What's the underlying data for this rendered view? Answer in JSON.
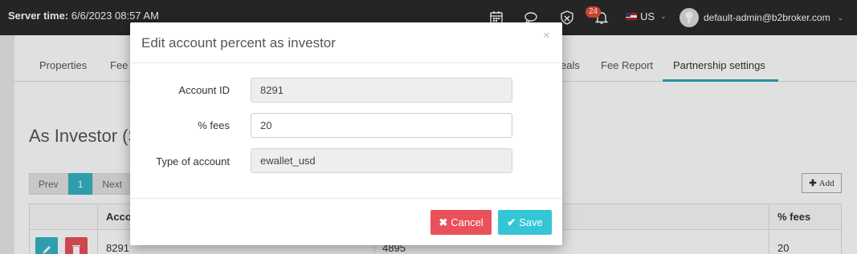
{
  "topbar": {
    "server_time_label": "Server time:",
    "server_time_value": "6/6/2023 08:57 AM",
    "notification_count": "24",
    "language": "US",
    "user_email": "default-admin@b2broker.com"
  },
  "tabs": [
    {
      "label": "Properties"
    },
    {
      "label": "Fee"
    },
    {
      "label": "eals"
    },
    {
      "label": "Fee Report"
    },
    {
      "label": "Partnership settings"
    }
  ],
  "section": {
    "title": "As Investor (S"
  },
  "pager": {
    "prev": "Prev",
    "current": "1",
    "next": "Next"
  },
  "add_button": "Add",
  "table": {
    "headers": {
      "account": "Acco",
      "fees": "% fees"
    },
    "row": {
      "account": "8291",
      "middle": "4895",
      "fees": "20"
    }
  },
  "modal": {
    "title": "Edit account percent as investor",
    "close": "×",
    "fields": [
      {
        "label": "Account ID",
        "value": "8291",
        "readonly": true
      },
      {
        "label": "% fees",
        "value": "20",
        "readonly": false
      },
      {
        "label": "Type of account",
        "value": "ewallet_usd",
        "readonly": true
      }
    ],
    "cancel_label": "Cancel",
    "save_label": "Save"
  },
  "colors": {
    "topbar": "#2b2b2b",
    "accent": "#35b3c6",
    "cancel": "#e9505a",
    "save": "#35c6d6",
    "badge": "#e74c3c"
  }
}
